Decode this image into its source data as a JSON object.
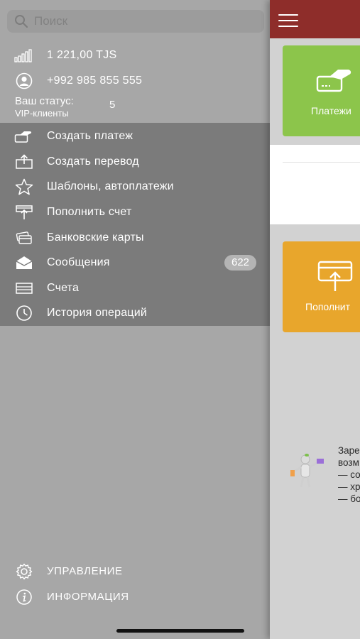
{
  "search": {
    "placeholder": "Поиск"
  },
  "account": {
    "balance": "1 221,00 TJS",
    "phone": "+992  985 855 555",
    "status_label": "Ваш статус:",
    "status_value": "VIP-клиенты",
    "status_number": "5"
  },
  "menu": [
    {
      "label": "Создать платеж",
      "icon": "payment-hand-icon"
    },
    {
      "label": "Создать перевод",
      "icon": "transfer-upload-icon"
    },
    {
      "label": "Шаблоны, автоплатежи",
      "icon": "star-icon"
    },
    {
      "label": "Пополнить счет",
      "icon": "top-up-icon"
    },
    {
      "label": "Банковские карты",
      "icon": "bank-cards-icon"
    },
    {
      "label": "Сообщения",
      "icon": "messages-envelope-icon",
      "badge": "622"
    },
    {
      "label": "Счета",
      "icon": "accounts-icon"
    },
    {
      "label": "История операций",
      "icon": "history-clock-icon"
    }
  ],
  "bottom_menu": [
    {
      "label": "УПРАВЛЕНИЕ",
      "icon": "gear-icon"
    },
    {
      "label": "ИНФОРМАЦИЯ",
      "icon": "info-icon"
    }
  ],
  "main": {
    "tile_payments_label": "Платежи",
    "tile_topup_label": "Пополнит",
    "promo_text": "Заре\nвозм\n— со\n— хр\n— бо"
  },
  "colors": {
    "drawer_bg": "#a7a7a7",
    "menu_bg": "#7b7b7b",
    "topbar": "#8e2d2a",
    "tile_green": "#8cc54b",
    "tile_orange": "#e8a62c"
  }
}
